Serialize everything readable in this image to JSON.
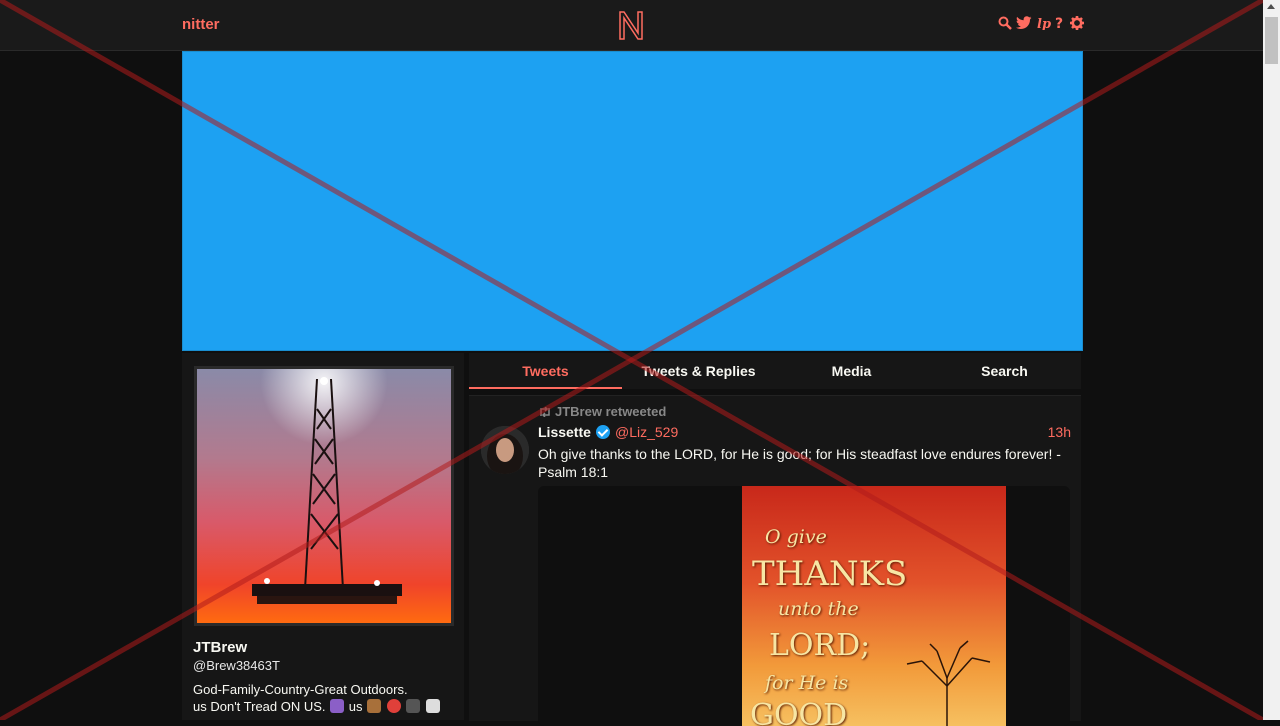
{
  "nav": {
    "brand": "nitter",
    "logo_letter": "N",
    "icons": [
      "search-icon",
      "twitter-bird-icon",
      "liberapay-icon",
      "help-icon",
      "gear-icon"
    ]
  },
  "colors": {
    "accent": "#ff6c60",
    "banner": "#1da1f2",
    "background": "#0f0f0f",
    "panel": "#161616",
    "navbar": "#1a1a1a",
    "overlay_cross": "#b01c1c"
  },
  "profile": {
    "fullname": "JTBrew",
    "username": "@Brew38463T",
    "bio_line1": "God-Family-Country-Great Outdoors.",
    "bio_line2_a": "us Don't Tread ON US.",
    "bio_line2_b": "us"
  },
  "tabs": [
    {
      "label": "Tweets",
      "active": true
    },
    {
      "label": "Tweets & Replies",
      "active": false
    },
    {
      "label": "Media",
      "active": false
    },
    {
      "label": "Search",
      "active": false
    }
  ],
  "tweet": {
    "retweet_header": "JTBrew retweeted",
    "name": "Lissette",
    "handle": "@Liz_529",
    "date": "13h",
    "text": "Oh give thanks to the LORD, for He is good; for His steadfast love endures forever! - Psalm 18:1",
    "image_text": {
      "line1": "O give",
      "line2": "THANKS",
      "line3": "unto the",
      "line4": "LORD;",
      "line5": "for He is",
      "line6": "GOOD"
    }
  }
}
